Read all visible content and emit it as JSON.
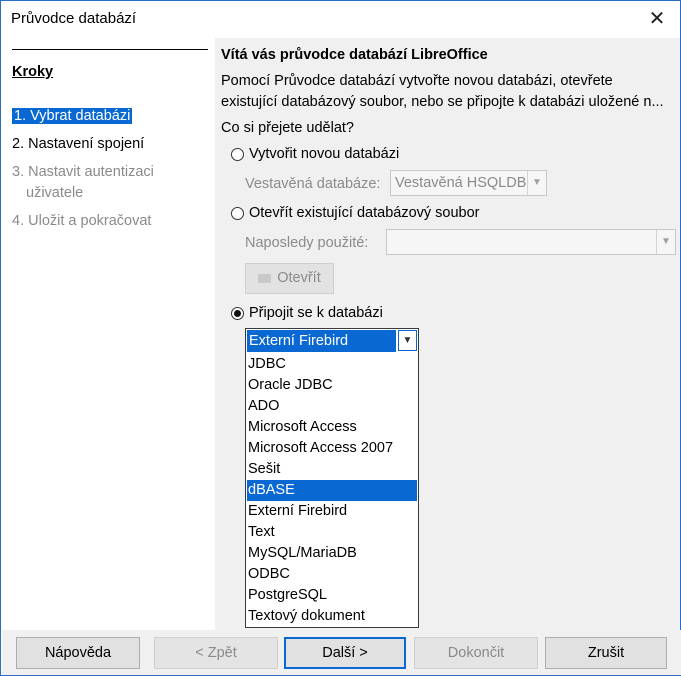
{
  "window": {
    "title": "Průvodce databází",
    "close_icon": "close-icon"
  },
  "steps": {
    "title": "Kroky",
    "items": [
      {
        "label": "1. Vybrat databázi",
        "state": "active"
      },
      {
        "label": "2. Nastavení spojení",
        "state": "normal"
      },
      {
        "label": "3. Nastavit autentizaci",
        "label2": "uživatele",
        "state": "disabled"
      },
      {
        "label": "4. Uložit a pokračovat",
        "state": "disabled"
      }
    ]
  },
  "main": {
    "heading": "Vítá vás průvodce databází LibreOffice",
    "description_line1": "Pomocí Průvodce databází vytvořte novou databázi, otevřete",
    "description_line2": "existující databázový soubor, nebo se připojte k databázi uložené n...",
    "question": "Co si přejete udělat?",
    "option_new": "Vytvořit novou databázi",
    "embedded_label": "Vestavěná databáze:",
    "embedded_value": "Vestavěná HSQLDB",
    "option_open": "Otevřít existující databázový soubor",
    "recent_label": "Naposledy použité:",
    "recent_value": "",
    "open_button": "Otevřít",
    "option_connect": "Připojit se k databázi",
    "selected_option": "connect",
    "connect_select": {
      "value": "Externí Firebird",
      "options": [
        "JDBC",
        "Oracle JDBC",
        "ADO",
        "Microsoft Access",
        "Microsoft Access 2007",
        "Sešit",
        "dBASE",
        "Externí Firebird",
        "Text",
        "MySQL/MariaDB",
        "ODBC",
        "PostgreSQL",
        "Textový dokument"
      ],
      "highlighted": "dBASE"
    }
  },
  "buttons": {
    "help": "Nápověda",
    "back": "< Zpět",
    "next": "Další >",
    "finish": "Dokončit",
    "cancel": "Zrušit"
  },
  "colors": {
    "accent": "#0a68d3",
    "panel": "#f0f0f0"
  }
}
